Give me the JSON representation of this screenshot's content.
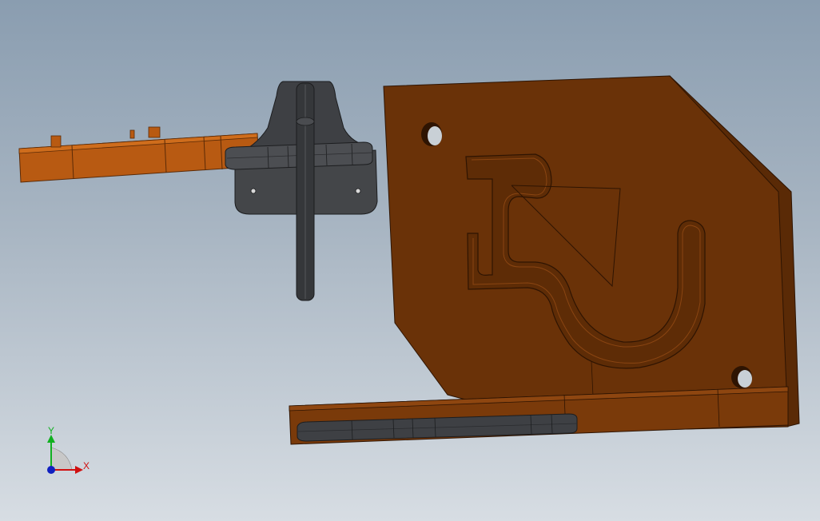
{
  "colors": {
    "background_top": "#8a9db0",
    "background_bottom": "#d7dde3",
    "plate_face": "#6a3208",
    "plate_side": "#5a2a06",
    "orange_part": "#b85a12",
    "dark_part": "#3e4044",
    "axis_x": "#d01010",
    "axis_y": "#10b020",
    "axis_z": "#1020c0"
  },
  "triad": {
    "x_label": "X",
    "y_label": "Y"
  }
}
